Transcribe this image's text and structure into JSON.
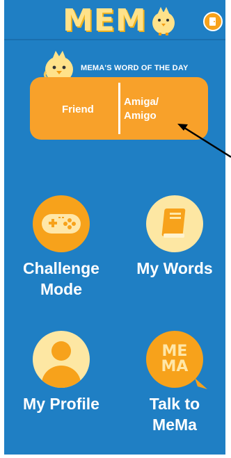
{
  "app": {
    "logo_text": "MEM",
    "menu_icon": "door-menu-icon"
  },
  "word_of_day": {
    "heading": "MEMA'S WORD OF THE DAY",
    "english": "Friend",
    "spanish": "Amiga/ Amigo"
  },
  "menu": {
    "challenge": {
      "label": "Challenge Mode",
      "icon": "gamepad-icon"
    },
    "my_words": {
      "label": "My Words",
      "icon": "book-icon"
    },
    "profile": {
      "label": "My Profile",
      "icon": "user-icon"
    },
    "talk": {
      "label": "Talk to MeMa",
      "icon": "mema-chat-icon",
      "icon_text_top": "ME",
      "icon_text_bottom": "MA"
    }
  },
  "colors": {
    "background": "#1f7fc4",
    "accent_orange": "#f7a21b",
    "card_orange": "#f8a12a",
    "cream": "#fde7a3",
    "logo_yellow": "#ffe28a"
  }
}
